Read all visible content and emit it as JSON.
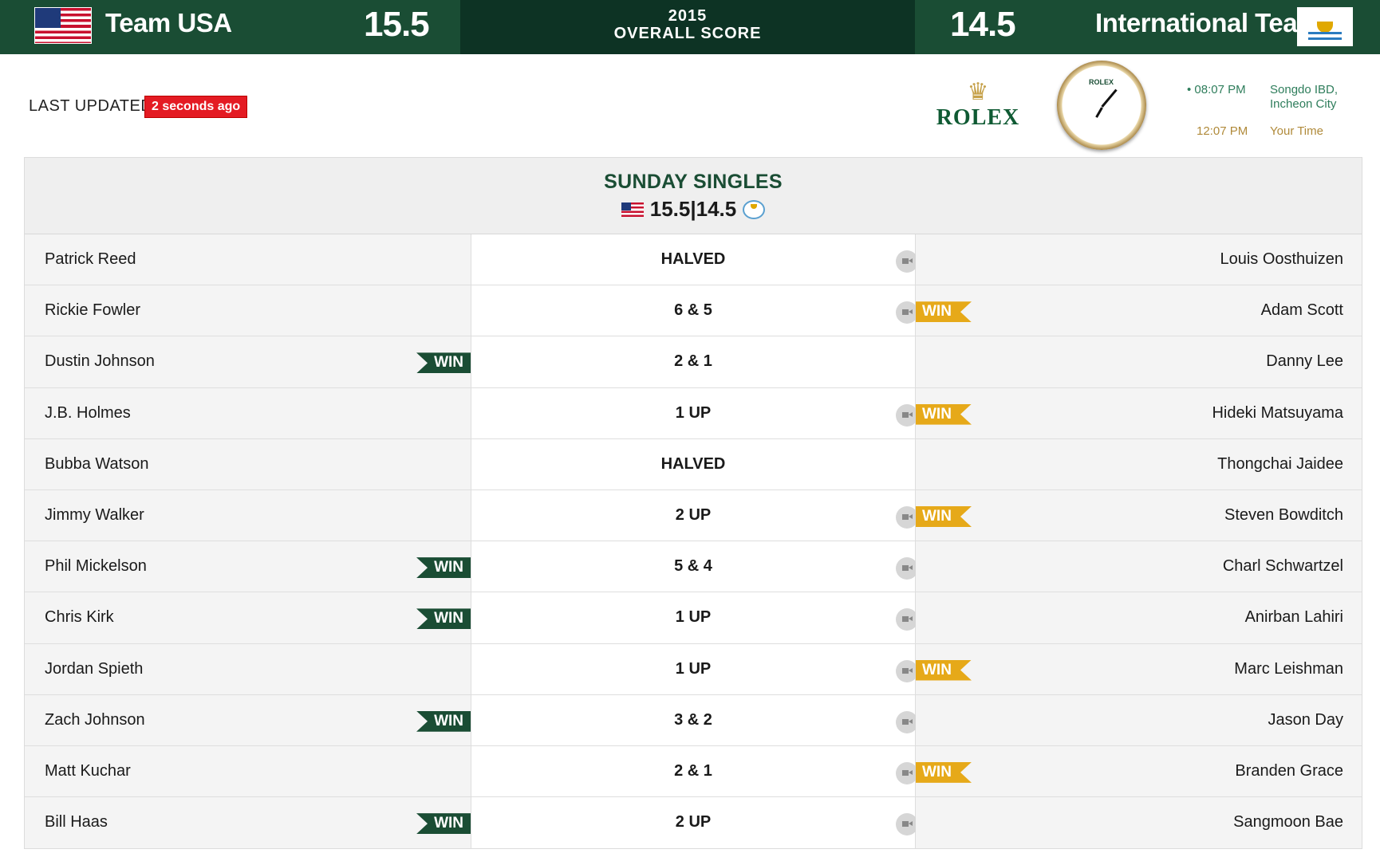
{
  "header": {
    "usa": {
      "name": "Team USA",
      "score": "15.5"
    },
    "intl": {
      "name": "International Team",
      "score": "14.5"
    },
    "year": "2015",
    "overall_label": "OVERALL SCORE"
  },
  "updated": {
    "label": "LAST UPDATED:",
    "value": "2 seconds ago"
  },
  "sponsor": {
    "brand": "ROLEX",
    "clock_text": "ROLEX"
  },
  "times": {
    "local_time": "08:07 PM",
    "local_place_line1": "Songdo IBD,",
    "local_place_line2": "Incheon City",
    "user_time": "12:07 PM",
    "user_label": "Your Time"
  },
  "session": {
    "title": "SUNDAY SINGLES",
    "score": "15.5|14.5"
  },
  "win_label": "WIN",
  "matches": [
    {
      "usa": "Patrick Reed",
      "result": "HALVED",
      "intl": "Louis Oosthuizen",
      "winner": "",
      "video": true
    },
    {
      "usa": "Rickie Fowler",
      "result": "6 & 5",
      "intl": "Adam Scott",
      "winner": "intl",
      "video": true
    },
    {
      "usa": "Dustin Johnson",
      "result": "2 & 1",
      "intl": "Danny Lee",
      "winner": "usa",
      "video": false
    },
    {
      "usa": "J.B. Holmes",
      "result": "1 UP",
      "intl": "Hideki Matsuyama",
      "winner": "intl",
      "video": true
    },
    {
      "usa": "Bubba Watson",
      "result": "HALVED",
      "intl": "Thongchai Jaidee",
      "winner": "",
      "video": false
    },
    {
      "usa": "Jimmy Walker",
      "result": "2 UP",
      "intl": "Steven Bowditch",
      "winner": "intl",
      "video": true
    },
    {
      "usa": "Phil Mickelson",
      "result": "5 & 4",
      "intl": "Charl Schwartzel",
      "winner": "usa",
      "video": true
    },
    {
      "usa": "Chris Kirk",
      "result": "1 UP",
      "intl": "Anirban Lahiri",
      "winner": "usa",
      "video": true
    },
    {
      "usa": "Jordan Spieth",
      "result": "1 UP",
      "intl": "Marc Leishman",
      "winner": "intl",
      "video": true
    },
    {
      "usa": "Zach Johnson",
      "result": "3 & 2",
      "intl": "Jason Day",
      "winner": "usa",
      "video": true
    },
    {
      "usa": "Matt Kuchar",
      "result": "2 & 1",
      "intl": "Branden Grace",
      "winner": "intl",
      "video": true
    },
    {
      "usa": "Bill Haas",
      "result": "2 UP",
      "intl": "Sangmoon Bae",
      "winner": "usa",
      "video": true
    }
  ]
}
